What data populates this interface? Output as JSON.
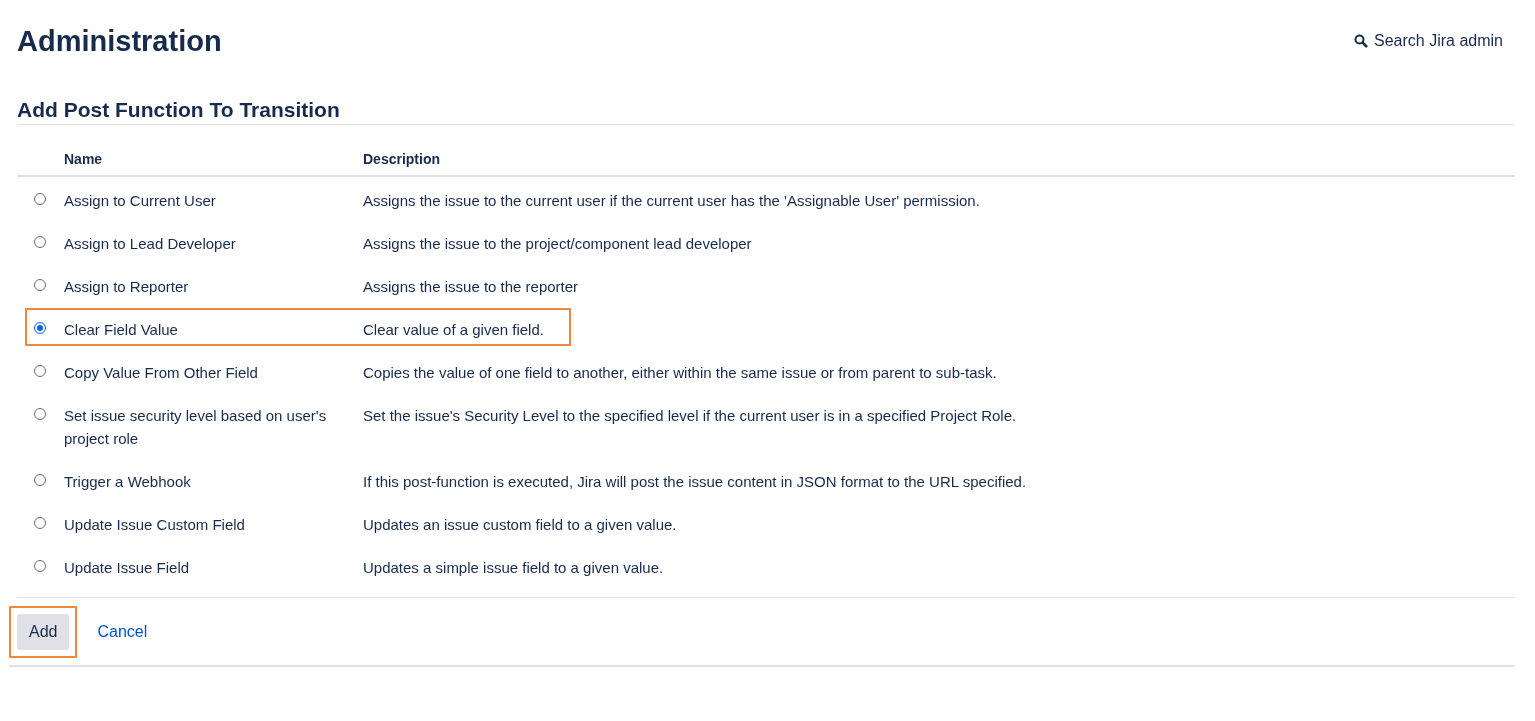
{
  "header": {
    "title": "Administration",
    "search_link": "Search Jira admin"
  },
  "section_title": "Add Post Function To Transition",
  "table": {
    "columns": [
      "Name",
      "Description"
    ],
    "rows": [
      {
        "name": "Assign to Current User",
        "description": "Assigns the issue to the current user if the current user has the 'Assignable User' permission.",
        "selected": false,
        "highlighted": false
      },
      {
        "name": "Assign to Lead Developer",
        "description": "Assigns the issue to the project/component lead developer",
        "selected": false,
        "highlighted": false
      },
      {
        "name": "Assign to Reporter",
        "description": "Assigns the issue to the reporter",
        "selected": false,
        "highlighted": false
      },
      {
        "name": "Clear Field Value",
        "description": "Clear value of a given field.",
        "selected": true,
        "highlighted": true
      },
      {
        "name": "Copy Value From Other Field",
        "description": "Copies the value of one field to another, either within the same issue or from parent to sub-task.",
        "selected": false,
        "highlighted": false
      },
      {
        "name": "Set issue security level based on user's project role",
        "description": "Set the issue's Security Level to the specified level if the current user is in a specified Project Role.",
        "selected": false,
        "highlighted": false
      },
      {
        "name": "Trigger a Webhook",
        "description": "If this post-function is executed, Jira will post the issue content in JSON format to the URL specified.",
        "selected": false,
        "highlighted": false
      },
      {
        "name": "Update Issue Custom Field",
        "description": "Updates an issue custom field to a given value.",
        "selected": false,
        "highlighted": false
      },
      {
        "name": "Update Issue Field",
        "description": "Updates a simple issue field to a given value.",
        "selected": false,
        "highlighted": false
      }
    ]
  },
  "actions": {
    "add": {
      "label": "Add",
      "highlighted": true
    },
    "cancel": "Cancel"
  }
}
